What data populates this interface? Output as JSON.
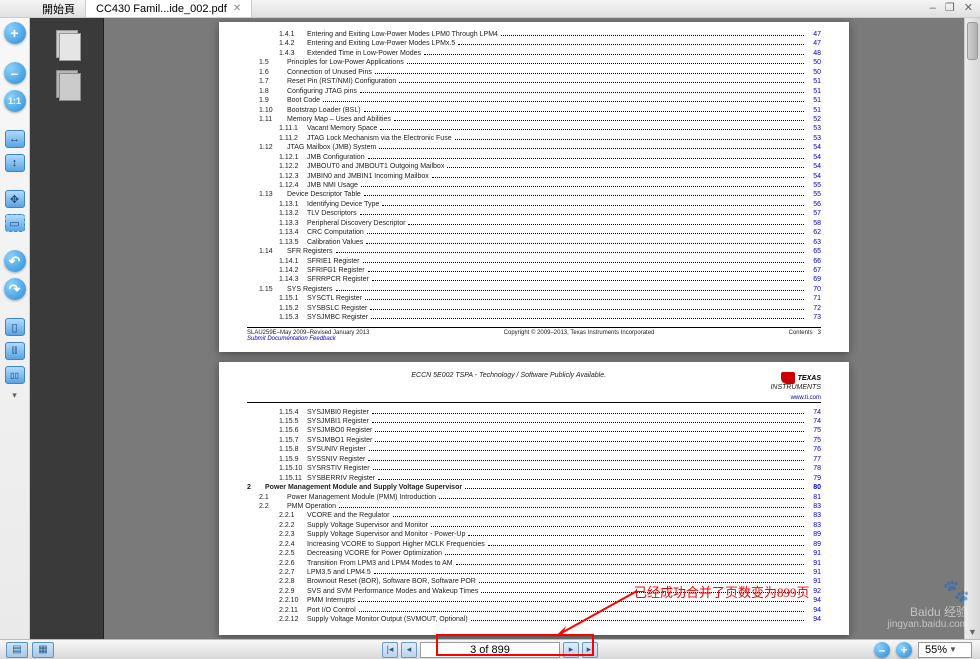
{
  "tabs": {
    "home": "開始頁",
    "doc": "CC430 Famil...ide_002.pdf"
  },
  "window_buttons": {
    "min": "–",
    "restore": "❐",
    "close": "✕"
  },
  "pager": {
    "text": "3 of 899"
  },
  "zoom": {
    "value": "55%"
  },
  "annotation": "已经成功合并了页数变为899页",
  "watermark": {
    "brand": "Baidu 经验",
    "url": "jingyan.baidu.com"
  },
  "page1_footer": {
    "line1": "SLAU259E–May 2009–Revised January 2013",
    "line2": "Submit Documentation Feedback",
    "center": "Copyright © 2009–2013, Texas Instruments Incorporated",
    "right1": "Contents",
    "right2": "3"
  },
  "page2_header": {
    "eccn": "ECCN 5E002 TSPA - Technology / Software Publicly Available.",
    "url": "www.ti.com"
  },
  "page1_toc": [
    {
      "n": "1.4.1",
      "t": "Entering and Exiting Low-Power Modes LPM0 Through LPM4",
      "p": "47",
      "i": 2
    },
    {
      "n": "1.4.2",
      "t": "Entering and Exiting Low-Power Modes LPMx.5",
      "p": "47",
      "i": 2
    },
    {
      "n": "1.4.3",
      "t": "Extended Time in Low-Power Modes",
      "p": "48",
      "i": 2
    },
    {
      "n": "1.5",
      "t": "Principles for Low-Power Applications",
      "p": "50",
      "i": 1
    },
    {
      "n": "1.6",
      "t": "Connection of Unused Pins",
      "p": "50",
      "i": 1
    },
    {
      "n": "1.7",
      "t": "Reset Pin (RST/NMI) Configuration",
      "p": "51",
      "i": 1
    },
    {
      "n": "1.8",
      "t": "Configuring JTAG pins",
      "p": "51",
      "i": 1
    },
    {
      "n": "1.9",
      "t": "Boot Code",
      "p": "51",
      "i": 1
    },
    {
      "n": "1.10",
      "t": "Bootstrap Loader (BSL)",
      "p": "51",
      "i": 1
    },
    {
      "n": "1.11",
      "t": "Memory Map – Uses and Abilities",
      "p": "52",
      "i": 1
    },
    {
      "n": "1.11.1",
      "t": "Vacant Memory Space",
      "p": "53",
      "i": 2
    },
    {
      "n": "1.11.2",
      "t": "JTAG Lock Mechanism via the Electronic Fuse",
      "p": "53",
      "i": 2
    },
    {
      "n": "1.12",
      "t": "JTAG Mailbox (JMB) System",
      "p": "54",
      "i": 1
    },
    {
      "n": "1.12.1",
      "t": "JMB Configuration",
      "p": "54",
      "i": 2
    },
    {
      "n": "1.12.2",
      "t": "JMBOUT0 and JMBOUT1 Outgoing Mailbox",
      "p": "54",
      "i": 2
    },
    {
      "n": "1.12.3",
      "t": "JMBIN0 and JMBIN1 Incoming Mailbox",
      "p": "54",
      "i": 2
    },
    {
      "n": "1.12.4",
      "t": "JMB NMI Usage",
      "p": "55",
      "i": 2
    },
    {
      "n": "1.13",
      "t": "Device Descriptor Table",
      "p": "55",
      "i": 1
    },
    {
      "n": "1.13.1",
      "t": "Identifying Device Type",
      "p": "56",
      "i": 2
    },
    {
      "n": "1.13.2",
      "t": "TLV Descriptors",
      "p": "57",
      "i": 2
    },
    {
      "n": "1.13.3",
      "t": "Peripheral Discovery Descriptor",
      "p": "58",
      "i": 2
    },
    {
      "n": "1.13.4",
      "t": "CRC Computation",
      "p": "62",
      "i": 2
    },
    {
      "n": "1.13.5",
      "t": "Calibration Values",
      "p": "63",
      "i": 2
    },
    {
      "n": "1.14",
      "t": "SFR Registers",
      "p": "65",
      "i": 1
    },
    {
      "n": "1.14.1",
      "t": "SFRIE1 Register",
      "p": "66",
      "i": 2
    },
    {
      "n": "1.14.2",
      "t": "SFRIFG1 Register",
      "p": "67",
      "i": 2
    },
    {
      "n": "1.14.3",
      "t": "SFRRPCR Register",
      "p": "69",
      "i": 2
    },
    {
      "n": "1.15",
      "t": "SYS Registers",
      "p": "70",
      "i": 1
    },
    {
      "n": "1.15.1",
      "t": "SYSCTL Register",
      "p": "71",
      "i": 2
    },
    {
      "n": "1.15.2",
      "t": "SYSBSLC Register",
      "p": "72",
      "i": 2
    },
    {
      "n": "1.15.3",
      "t": "SYSJMBC Register",
      "p": "73",
      "i": 2
    }
  ],
  "page2_toc": [
    {
      "n": "1.15.4",
      "t": "SYSJMBI0 Register",
      "p": "74",
      "i": 2
    },
    {
      "n": "1.15.5",
      "t": "SYSJMBI1 Register",
      "p": "74",
      "i": 2
    },
    {
      "n": "1.15.6",
      "t": "SYSJMBO0 Register",
      "p": "75",
      "i": 2
    },
    {
      "n": "1.15.7",
      "t": "SYSJMBO1 Register",
      "p": "75",
      "i": 2
    },
    {
      "n": "1.15.8",
      "t": "SYSUNIV Register",
      "p": "76",
      "i": 2
    },
    {
      "n": "1.15.9",
      "t": "SYSSNIV Register",
      "p": "77",
      "i": 2
    },
    {
      "n": "1.15.10",
      "t": "SYSRSTIV Register",
      "p": "78",
      "i": 2
    },
    {
      "n": "1.15.11",
      "t": "SYSBERRIV Register",
      "p": "79",
      "i": 2
    },
    {
      "n": "2",
      "t": "Power Management Module and Supply Voltage Supervisor",
      "p": "80",
      "i": 0,
      "b": 1
    },
    {
      "n": "2.1",
      "t": "Power Management Module (PMM) Introduction",
      "p": "81",
      "i": 1
    },
    {
      "n": "2.2",
      "t": "PMM Operation",
      "p": "83",
      "i": 1
    },
    {
      "n": "2.2.1",
      "t": "VCORE and the Regulator",
      "p": "83",
      "i": 2
    },
    {
      "n": "2.2.2",
      "t": "Supply Voltage Supervisor and Monitor",
      "p": "83",
      "i": 2
    },
    {
      "n": "2.2.3",
      "t": "Supply Voltage Supervisor and Monitor - Power-Up",
      "p": "89",
      "i": 2
    },
    {
      "n": "2.2.4",
      "t": "Increasing VCORE to Support Higher MCLK Frequencies",
      "p": "89",
      "i": 2
    },
    {
      "n": "2.2.5",
      "t": "Decreasing VCORE for Power Optimization",
      "p": "91",
      "i": 2
    },
    {
      "n": "2.2.6",
      "t": "Transition From LPM3 and LPM4 Modes to AM",
      "p": "91",
      "i": 2
    },
    {
      "n": "2.2.7",
      "t": "LPM3.5 and LPM4.5",
      "p": "91",
      "i": 2
    },
    {
      "n": "2.2.8",
      "t": "Brownout Reset (BOR), Software BOR, Software POR",
      "p": "91",
      "i": 2
    },
    {
      "n": "2.2.9",
      "t": "SVS and SVM Performance Modes and Wakeup Times",
      "p": "92",
      "i": 2
    },
    {
      "n": "2.2.10",
      "t": "PMM Interrupts",
      "p": "94",
      "i": 2
    },
    {
      "n": "2.2.11",
      "t": "Port I/O Control",
      "p": "94",
      "i": 2
    },
    {
      "n": "2.2.12",
      "t": "Supply Voltage Monitor Output (SVMOUT, Optional)",
      "p": "94",
      "i": 2
    }
  ]
}
